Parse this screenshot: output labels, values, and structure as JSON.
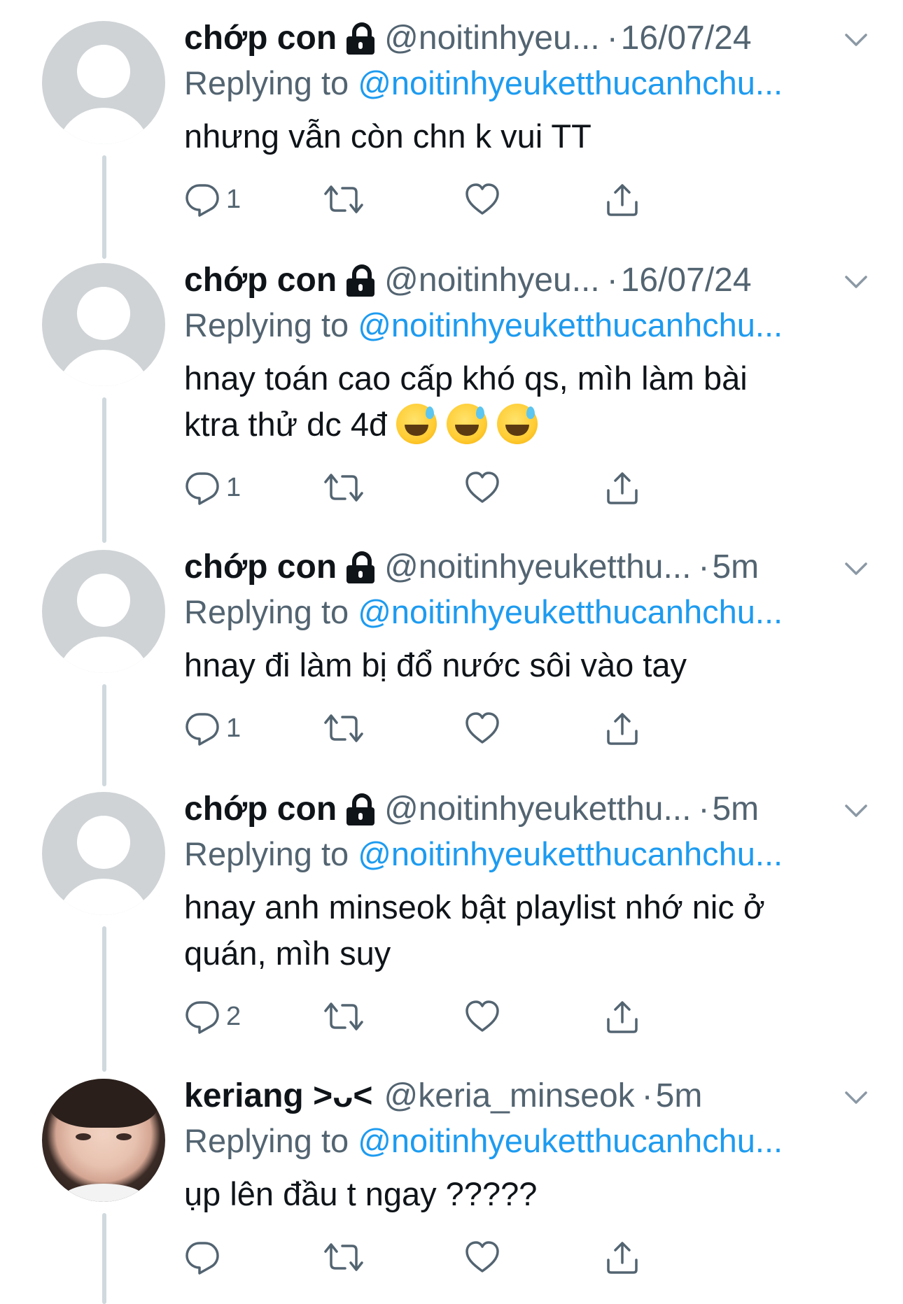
{
  "colors": {
    "text": "#0f1419",
    "secondary": "#536471",
    "link": "#1d9bf0",
    "thread_line": "#cfd9de",
    "avatar_placeholder": "#cfd3d6"
  },
  "tweets": [
    {
      "name": "chớp con",
      "handle": "@noitinhyeu...",
      "time": "16/07/24",
      "reply_prefix": "Replying to ",
      "reply_to": "@noitinhyeuketthucanhchu...",
      "text": "nhưng vẫn còn chn k vui TT",
      "reply_count": "1",
      "protected": true,
      "avatar": "default"
    },
    {
      "name": "chớp con",
      "handle": "@noitinhyeu...",
      "time": "16/07/24",
      "reply_prefix": "Replying to ",
      "reply_to": "@noitinhyeuketthucanhchu...",
      "text_line1": "hnay toán cao cấp khó qs, mìh làm bài",
      "text_line2": "ktra thử dc 4đ",
      "emoji": "sweat-smile-emoji",
      "reply_count": "1",
      "protected": true,
      "avatar": "default"
    },
    {
      "name": "chớp con",
      "handle": "@noitinhyeuketthu...",
      "time": "5m",
      "reply_prefix": "Replying to ",
      "reply_to": "@noitinhyeuketthucanhchu...",
      "text": "hnay đi làm bị đổ nước sôi vào tay",
      "reply_count": "1",
      "protected": true,
      "avatar": "default"
    },
    {
      "name": "chớp con",
      "handle": "@noitinhyeuketthu...",
      "time": "5m",
      "reply_prefix": "Replying to ",
      "reply_to": "@noitinhyeuketthucanhchu...",
      "text_line1": "hnay anh minseok bật playlist nhớ nic ở",
      "text_line2": "quán, mìh suy",
      "reply_count": "2",
      "protected": true,
      "avatar": "default"
    },
    {
      "name": "keriang >ᴗ<",
      "handle": "@keria_minseok",
      "time": "5m",
      "reply_prefix": "Replying to ",
      "reply_to": "@noitinhyeuketthucanhchu...",
      "text": "ụp lên đầu t ngay ?????",
      "reply_count": "",
      "protected": false,
      "avatar": "photo"
    }
  ],
  "icons": {
    "reply": "reply-icon",
    "retweet": "retweet-icon",
    "like": "heart-icon",
    "share": "share-icon",
    "more": "chevron-down-icon",
    "lock": "lock-icon"
  }
}
